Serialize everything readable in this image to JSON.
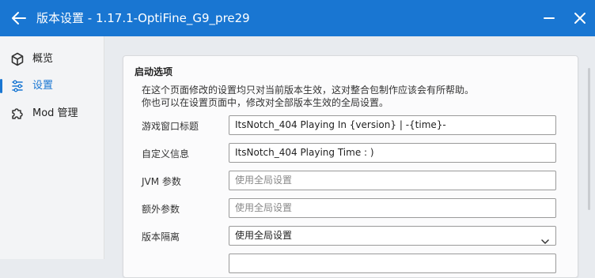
{
  "titlebar": {
    "title": "版本设置 - 1.17.1-OptiFine_G9_pre29",
    "accent": "#1976d2"
  },
  "sidebar": {
    "items": [
      {
        "label": "概览",
        "icon": "cube-icon",
        "active": false
      },
      {
        "label": "设置",
        "icon": "settings-bars-icon",
        "active": true
      },
      {
        "label": "Mod 管理",
        "icon": "puzzle-icon",
        "active": false
      }
    ]
  },
  "launch": {
    "heading": "启动选项",
    "desc1": "在这个页面修改的设置均只对当前版本生效，这对整合包制作应该会有所帮助。",
    "desc2": "你也可以在设置页面中，修改对全部版本生效的全局设置。",
    "rows": [
      {
        "label": "游戏窗口标题",
        "value": "ItsNotch_404 Playing In {version} | -{time}-"
      },
      {
        "label": "自定义信息",
        "value": "ItsNotch_404 Playing Time : )"
      },
      {
        "label": "JVM 参数",
        "placeholder": "使用全局设置"
      },
      {
        "label": "额外参数",
        "placeholder": "使用全局设置"
      },
      {
        "label": "版本隔离",
        "value": "使用全局设置"
      }
    ]
  }
}
